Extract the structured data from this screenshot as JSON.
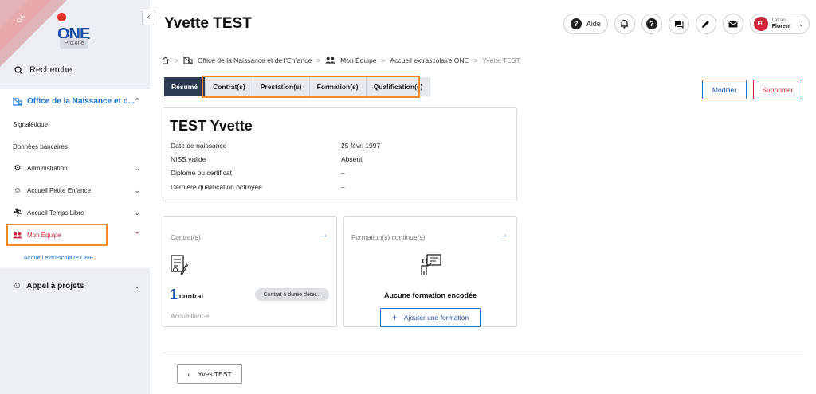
{
  "sidebar": {
    "env_label": "QA",
    "brand": "ONE",
    "badge": "Pro.one",
    "search_label": "Rechercher",
    "org_label": "Office de la Naissance et d...",
    "links": {
      "signaletique": "Signalétique",
      "donnees": "Données bancaires"
    },
    "items": [
      {
        "label": "Administration"
      },
      {
        "label": "Accueil Petite Enfance"
      },
      {
        "label": "Accueil Temps Libre"
      },
      {
        "label": "Mon Equipe"
      }
    ],
    "subitem": "Accueil extrascolaire ONE",
    "appel": "Appel à projets"
  },
  "header": {
    "title": "Yvette TEST",
    "help_label": "Aide",
    "user": {
      "initials": "FL",
      "first_name": "Latran",
      "last_name": "Florent"
    }
  },
  "breadcrumb": [
    "Office de la Naissance et de l'Enfance",
    "Mon Équipe",
    "Accueil extrascolaire ONE",
    "Yvette TEST"
  ],
  "tabs": [
    {
      "label": "Résumé",
      "active": true
    },
    {
      "label": "Contrat(s)",
      "active": false
    },
    {
      "label": "Prestation(s)",
      "active": false
    },
    {
      "label": "Formation(s)",
      "active": false
    },
    {
      "label": "Qualification(s)",
      "active": false
    }
  ],
  "actions": {
    "modify": "Modifier",
    "delete": "Supprimer"
  },
  "summary": {
    "name": "TEST Yvette",
    "rows": [
      {
        "label": "Date de naissance",
        "value": "25 févr. 1997"
      },
      {
        "label": "NISS valide",
        "value": "Absent"
      },
      {
        "label": "Diplome ou certificat",
        "value": "–"
      },
      {
        "label": "Dernière qualification octroyée",
        "value": "–"
      }
    ]
  },
  "contrat_card": {
    "title": "Contrat(s)",
    "count": "1",
    "count_label": "contrat",
    "chip": "Contrat à durée déter...",
    "role": "Accueillant·e"
  },
  "formation_card": {
    "title": "Formation(s) continue(s)",
    "empty": "Aucune formation encodée",
    "add": "Ajouter une formation"
  },
  "footer": {
    "back": "Yves TEST"
  }
}
